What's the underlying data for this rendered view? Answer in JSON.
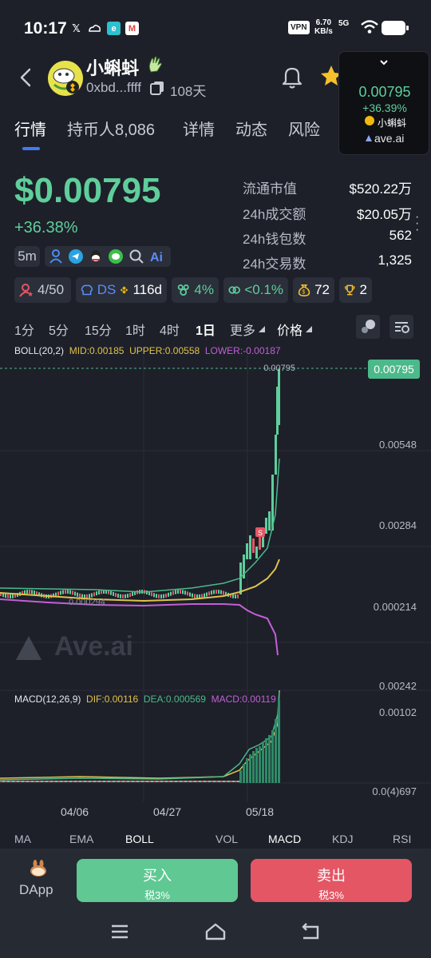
{
  "status_bar": {
    "time": "10:17",
    "vpn": "VPN",
    "speed_value": "6.70",
    "speed_unit": "KB/s",
    "network": "5G"
  },
  "header": {
    "token_name": "小蝌蚪",
    "address": "0xbd...ffff",
    "age": "108天"
  },
  "popup": {
    "price": "0.00795",
    "change": "+36.39%",
    "name": "小蝌蚪",
    "site": "ave.ai"
  },
  "tabs": [
    "行情",
    "持币人8,086",
    "详情",
    "动态",
    "风险"
  ],
  "price": {
    "value": "$0.00795",
    "change": "+36.38%",
    "timeframe": "5m"
  },
  "stats": [
    {
      "label": "流通市值",
      "value": "$520.22万"
    },
    {
      "label": "24h成交额",
      "value": "$20.05万"
    },
    {
      "label": "24h钱包数",
      "value": "562"
    },
    {
      "label": "24h交易数",
      "value": "1,325"
    }
  ],
  "badges": {
    "holders": "4/50",
    "ds": "DS",
    "age": "116d",
    "pct1": "4%",
    "pct2": "<0.1%",
    "money": "72",
    "trophy": "2"
  },
  "intervals": [
    "1分",
    "5分",
    "15分",
    "1时",
    "4时",
    "1日",
    "更多",
    "价格"
  ],
  "boll": {
    "name": "BOLL(20,2)",
    "mid": "MID:0.00185",
    "upper": "UPPER:0.00558",
    "lower": "LOWER:-0.00187"
  },
  "chart_axis": {
    "top_marker": "0.00795",
    "current_tag": "0.00795",
    "labels": [
      "0.00548",
      "0.00284",
      "0.000214",
      "0.00242"
    ],
    "low_marker": "0.000294",
    "macd_labels": [
      "0.00102",
      "0.0(4)697"
    ],
    "watermark": "Ave.ai"
  },
  "macd": {
    "name": "MACD(12,26,9)",
    "dif": "DIF:0.00116",
    "dea": "DEA:0.000569",
    "macd": "MACD:0.00119"
  },
  "dates": [
    "04/06",
    "04/27",
    "05/18"
  ],
  "indicator_tabs": [
    "MA",
    "EMA",
    "BOLL",
    "VOL",
    "MACD",
    "KDJ",
    "RSI"
  ],
  "bottom": {
    "dapp": "DApp",
    "buy": "买入",
    "buy_tax": "税3%",
    "sell": "卖出",
    "sell_tax": "税3%"
  },
  "colors": {
    "up": "#5fce9b",
    "down": "#e45664",
    "accent": "#3f7cf2",
    "boll_mid": "#e0c24b",
    "boll_lower": "#c35fd6",
    "background": "#1d2029"
  }
}
